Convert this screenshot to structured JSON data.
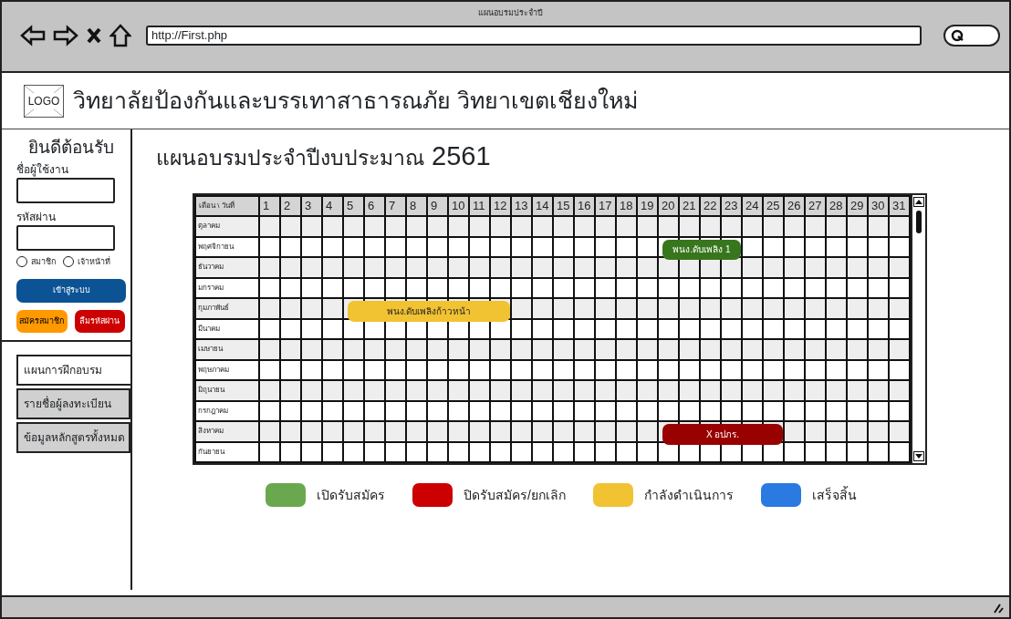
{
  "window": {
    "title": "แผนอบรมประจำปี",
    "url": "http://First.php"
  },
  "header": {
    "logo": "LOGO",
    "title": "วิทยาลัยป้องกันและบรรเทาสาธารณภัย วิทยาเขตเชียงใหม่"
  },
  "login": {
    "title": "ยินดีต้อนรับ",
    "fields": [
      {
        "label": "ชื่อผู้ใช้งาน"
      },
      {
        "label": "รหัสผ่าน"
      }
    ],
    "roles": [
      {
        "label": "สมาชิก",
        "checked": false
      },
      {
        "label": "เจ้าหน้าที่",
        "checked": false
      }
    ],
    "buttons": [
      {
        "label": "เข้าสู่ระบบ",
        "kind": "primary"
      },
      {
        "label": "สมัครสมาชิก",
        "kind": "warning"
      },
      {
        "label": "ลืมรหัสผ่าน",
        "kind": "danger"
      }
    ]
  },
  "tabs": [
    {
      "label": "แผนการฝึกอบรม",
      "selected": true
    },
    {
      "label": "รายชื่อผู้ลงทะเบียน",
      "selected": false
    },
    {
      "label": "ข้อมูลหลักสูตรทั้งหมด",
      "selected": false
    }
  ],
  "heading": {
    "text": "แผนอบรมประจำปีงบประมาณ",
    "year": "2561"
  },
  "table": {
    "corner": "เดือน \\ วันที่",
    "days": [
      "1",
      "2",
      "3",
      "4",
      "5",
      "6",
      "7",
      "8",
      "9",
      "10",
      "11",
      "12",
      "13",
      "14",
      "15",
      "16",
      "17",
      "18",
      "19",
      "20",
      "21",
      "22",
      "23",
      "24",
      "25",
      "26",
      "27",
      "28",
      "29",
      "30",
      "31"
    ],
    "months": [
      {
        "label": "ตุลาคม"
      },
      {
        "label": "พฤศจิกายน",
        "events": [
          {
            "label": "พนง.ดับเพลิง 1",
            "color": "#38761d"
          }
        ]
      },
      {
        "label": "ธันวาคม"
      },
      {
        "label": "มกราคม"
      },
      {
        "label": "กุมภาพันธ์",
        "events": [
          {
            "label": "พนง.ดับเพลิงก้าวหน้า",
            "color": "#f1c232"
          }
        ]
      },
      {
        "label": "มีนาคม"
      },
      {
        "label": "เมษายน"
      },
      {
        "label": "พฤษภาคม"
      },
      {
        "label": "มิถุนายน"
      },
      {
        "label": "กรกฎาคม"
      },
      {
        "label": "สิงหาคม",
        "events": [
          {
            "label": "X อปภร.",
            "color": "#990000"
          }
        ]
      },
      {
        "label": "กันยายน"
      }
    ]
  },
  "legend": [
    {
      "label": "เปิดรับสมัคร",
      "color": "#6aa84f"
    },
    {
      "label": "ปิดรับสมัคร/ยกเลิก",
      "color": "#cc0000"
    },
    {
      "label": "กำลังดำเนินการ",
      "color": "#f1c232"
    },
    {
      "label": "เสร็จสิ้น",
      "color": "#2a7ae2"
    }
  ]
}
